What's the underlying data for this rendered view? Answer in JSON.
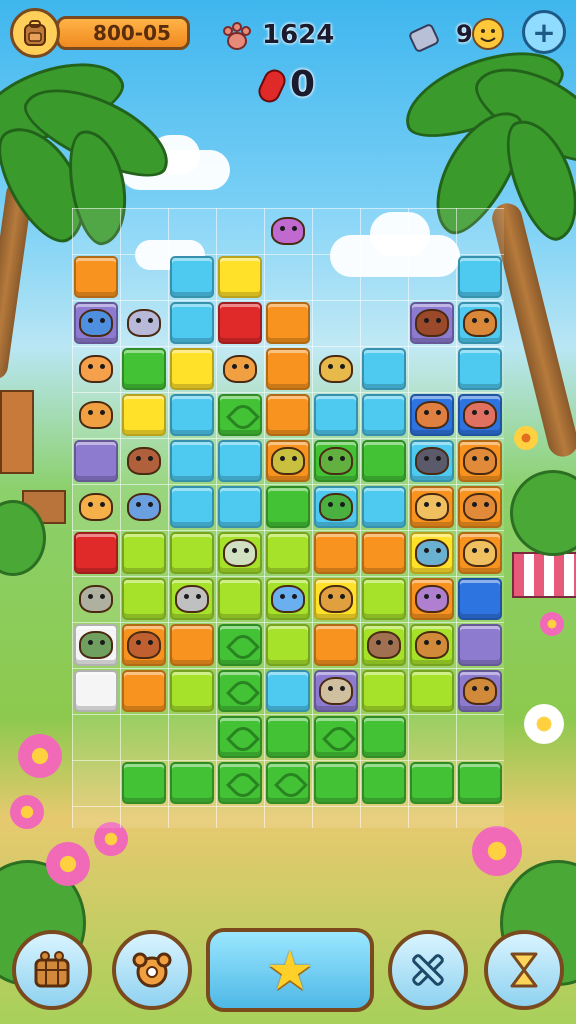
{
  "hud": {
    "coins": "800-05",
    "pawprints": "1624",
    "gems": "0",
    "secondary_count": "9"
  },
  "colors": {
    "orange": "#f7931e",
    "red": "#e02a2a",
    "yellow": "#ffe12a",
    "cyan": "#4ec9ef",
    "blue": "#2e74e0",
    "purple": "#8d7bd0",
    "green": "#44c235",
    "lime": "#a6e22a",
    "white": "#f5f5f5"
  },
  "board": {
    "tiles": [
      {
        "c": 0,
        "r": 1,
        "color": "orange"
      },
      {
        "c": 2,
        "r": 1,
        "color": "cyan"
      },
      {
        "c": 3,
        "r": 1,
        "color": "yellow"
      },
      {
        "c": 8,
        "r": 1,
        "color": "cyan"
      },
      {
        "c": 0,
        "r": 2,
        "color": "purple"
      },
      {
        "c": 2,
        "r": 2,
        "color": "cyan"
      },
      {
        "c": 3,
        "r": 2,
        "color": "red"
      },
      {
        "c": 4,
        "r": 2,
        "color": "orange"
      },
      {
        "c": 7,
        "r": 2,
        "color": "purple"
      },
      {
        "c": 8,
        "r": 2,
        "color": "cyan"
      },
      {
        "c": 1,
        "r": 3,
        "color": "green"
      },
      {
        "c": 2,
        "r": 3,
        "color": "yellow"
      },
      {
        "c": 4,
        "r": 3,
        "color": "orange"
      },
      {
        "c": 6,
        "r": 3,
        "color": "cyan"
      },
      {
        "c": 8,
        "r": 3,
        "color": "cyan"
      },
      {
        "c": 1,
        "r": 4,
        "color": "yellow"
      },
      {
        "c": 2,
        "r": 4,
        "color": "cyan"
      },
      {
        "c": 3,
        "r": 4,
        "color": "green",
        "leafy": true
      },
      {
        "c": 4,
        "r": 4,
        "color": "orange"
      },
      {
        "c": 5,
        "r": 4,
        "color": "cyan"
      },
      {
        "c": 6,
        "r": 4,
        "color": "cyan"
      },
      {
        "c": 7,
        "r": 4,
        "color": "blue"
      },
      {
        "c": 8,
        "r": 4,
        "color": "blue"
      },
      {
        "c": 0,
        "r": 5,
        "color": "purple"
      },
      {
        "c": 2,
        "r": 5,
        "color": "cyan"
      },
      {
        "c": 3,
        "r": 5,
        "color": "cyan"
      },
      {
        "c": 4,
        "r": 5,
        "color": "orange"
      },
      {
        "c": 5,
        "r": 5,
        "color": "green"
      },
      {
        "c": 6,
        "r": 5,
        "color": "green"
      },
      {
        "c": 7,
        "r": 5,
        "color": "cyan"
      },
      {
        "c": 8,
        "r": 5,
        "color": "orange"
      },
      {
        "c": 2,
        "r": 6,
        "color": "cyan"
      },
      {
        "c": 3,
        "r": 6,
        "color": "cyan"
      },
      {
        "c": 4,
        "r": 6,
        "color": "green"
      },
      {
        "c": 5,
        "r": 6,
        "color": "cyan"
      },
      {
        "c": 6,
        "r": 6,
        "color": "cyan"
      },
      {
        "c": 7,
        "r": 6,
        "color": "orange"
      },
      {
        "c": 8,
        "r": 6,
        "color": "orange"
      },
      {
        "c": 0,
        "r": 7,
        "color": "red"
      },
      {
        "c": 1,
        "r": 7,
        "color": "lime"
      },
      {
        "c": 2,
        "r": 7,
        "color": "lime"
      },
      {
        "c": 3,
        "r": 7,
        "color": "lime"
      },
      {
        "c": 4,
        "r": 7,
        "color": "lime"
      },
      {
        "c": 5,
        "r": 7,
        "color": "orange"
      },
      {
        "c": 6,
        "r": 7,
        "color": "orange"
      },
      {
        "c": 7,
        "r": 7,
        "color": "yellow"
      },
      {
        "c": 8,
        "r": 7,
        "color": "orange"
      },
      {
        "c": 1,
        "r": 8,
        "color": "lime"
      },
      {
        "c": 2,
        "r": 8,
        "color": "lime"
      },
      {
        "c": 3,
        "r": 8,
        "color": "lime"
      },
      {
        "c": 4,
        "r": 8,
        "color": "lime"
      },
      {
        "c": 5,
        "r": 8,
        "color": "yellow"
      },
      {
        "c": 6,
        "r": 8,
        "color": "lime"
      },
      {
        "c": 7,
        "r": 8,
        "color": "orange"
      },
      {
        "c": 8,
        "r": 8,
        "color": "blue"
      },
      {
        "c": 0,
        "r": 9,
        "color": "white"
      },
      {
        "c": 1,
        "r": 9,
        "color": "orange"
      },
      {
        "c": 2,
        "r": 9,
        "color": "orange"
      },
      {
        "c": 3,
        "r": 9,
        "color": "green",
        "leafy": true
      },
      {
        "c": 4,
        "r": 9,
        "color": "lime"
      },
      {
        "c": 5,
        "r": 9,
        "color": "orange"
      },
      {
        "c": 6,
        "r": 9,
        "color": "lime"
      },
      {
        "c": 7,
        "r": 9,
        "color": "lime"
      },
      {
        "c": 8,
        "r": 9,
        "color": "purple"
      },
      {
        "c": 0,
        "r": 10,
        "color": "white"
      },
      {
        "c": 1,
        "r": 10,
        "color": "orange"
      },
      {
        "c": 2,
        "r": 10,
        "color": "lime"
      },
      {
        "c": 3,
        "r": 10,
        "color": "green",
        "leafy": true
      },
      {
        "c": 4,
        "r": 10,
        "color": "cyan"
      },
      {
        "c": 5,
        "r": 10,
        "color": "purple"
      },
      {
        "c": 6,
        "r": 10,
        "color": "lime"
      },
      {
        "c": 7,
        "r": 10,
        "color": "lime"
      },
      {
        "c": 8,
        "r": 10,
        "color": "purple"
      },
      {
        "c": 3,
        "r": 11,
        "color": "green",
        "leafy": true
      },
      {
        "c": 4,
        "r": 11,
        "color": "green"
      },
      {
        "c": 5,
        "r": 11,
        "color": "green",
        "leafy": true
      },
      {
        "c": 6,
        "r": 11,
        "color": "green"
      },
      {
        "c": 1,
        "r": 12,
        "color": "green"
      },
      {
        "c": 2,
        "r": 12,
        "color": "green"
      },
      {
        "c": 3,
        "r": 12,
        "color": "green",
        "leafy": true
      },
      {
        "c": 4,
        "r": 12,
        "color": "green",
        "leafy": true
      },
      {
        "c": 5,
        "r": 12,
        "color": "green"
      },
      {
        "c": 6,
        "r": 12,
        "color": "green"
      },
      {
        "c": 7,
        "r": 12,
        "color": "green"
      },
      {
        "c": 8,
        "r": 12,
        "color": "green"
      }
    ],
    "animals": [
      {
        "c": 4,
        "r": 0,
        "color": "#c06ad0",
        "name": "bear-cub-animal"
      },
      {
        "c": 0,
        "r": 2,
        "color": "#4f8fe0",
        "name": "blue-cat-animal"
      },
      {
        "c": 1,
        "r": 2,
        "color": "#b8b8d8",
        "name": "grey-cat-animal"
      },
      {
        "c": 0,
        "r": 3,
        "color": "#f5a04a",
        "name": "orange-fox-animal"
      },
      {
        "c": 3,
        "r": 3,
        "color": "#f0a040",
        "name": "squirrel-animal"
      },
      {
        "c": 5,
        "r": 3,
        "color": "#e7b84a",
        "name": "owl-animal"
      },
      {
        "c": 7,
        "r": 2,
        "color": "#9a4a2a",
        "name": "lion-animal"
      },
      {
        "c": 8,
        "r": 2,
        "color": "#d9883a",
        "name": "monkey-animal"
      },
      {
        "c": 0,
        "r": 4,
        "color": "#f0a040",
        "name": "dog-animal"
      },
      {
        "c": 7,
        "r": 4,
        "color": "#e08040",
        "name": "butterfly-animal"
      },
      {
        "c": 8,
        "r": 4,
        "color": "#e07060",
        "name": "bird-animal"
      },
      {
        "c": 1,
        "r": 5,
        "color": "#b0603a",
        "name": "bull-animal"
      },
      {
        "c": 4,
        "r": 5,
        "color": "#c9c040",
        "name": "frog-animal"
      },
      {
        "c": 5,
        "r": 5,
        "color": "#62b040",
        "name": "lizard-animal"
      },
      {
        "c": 7,
        "r": 5,
        "color": "#5a5a6a",
        "name": "gorilla-animal"
      },
      {
        "c": 8,
        "r": 5,
        "color": "#e08a3a",
        "name": "fox-animal"
      },
      {
        "c": 0,
        "r": 6,
        "color": "#f5b04a",
        "name": "lion-cub-animal"
      },
      {
        "c": 1,
        "r": 6,
        "color": "#6aa0e0",
        "name": "penguin-animal"
      },
      {
        "c": 5,
        "r": 6,
        "color": "#4ab040",
        "name": "dino-animal"
      },
      {
        "c": 7,
        "r": 6,
        "color": "#f0c060",
        "name": "cat-animal"
      },
      {
        "c": 8,
        "r": 6,
        "color": "#e08a3a",
        "name": "small-fox-animal"
      },
      {
        "c": 3,
        "r": 7,
        "color": "#d0e0c0",
        "name": "panda-animal"
      },
      {
        "c": 7,
        "r": 7,
        "color": "#6ab0d0",
        "name": "seal-animal"
      },
      {
        "c": 8,
        "r": 7,
        "color": "#f0c060",
        "name": "tabby-animal"
      },
      {
        "c": 0,
        "r": 8,
        "color": "#b0b0a0",
        "name": "wolf-animal"
      },
      {
        "c": 2,
        "r": 8,
        "color": "#c0c0c0",
        "name": "horse-animal"
      },
      {
        "c": 4,
        "r": 8,
        "color": "#6ab0f0",
        "name": "husky-animal"
      },
      {
        "c": 5,
        "r": 8,
        "color": "#e0a040",
        "name": "robot-animal"
      },
      {
        "c": 7,
        "r": 8,
        "color": "#b080d0",
        "name": "purple-cat-animal"
      },
      {
        "c": 0,
        "r": 9,
        "color": "#70a060",
        "name": "turtle-animal"
      },
      {
        "c": 1,
        "r": 9,
        "color": "#c06030",
        "name": "bear-animal"
      },
      {
        "c": 6,
        "r": 9,
        "color": "#a07050",
        "name": "rat-animal"
      },
      {
        "c": 7,
        "r": 9,
        "color": "#d08a3a",
        "name": "puppy-animal"
      },
      {
        "c": 5,
        "r": 10,
        "color": "#d0c0a0",
        "name": "deer-animal"
      },
      {
        "c": 8,
        "r": 10,
        "color": "#d08a3a",
        "name": "hamster-animal"
      }
    ]
  }
}
